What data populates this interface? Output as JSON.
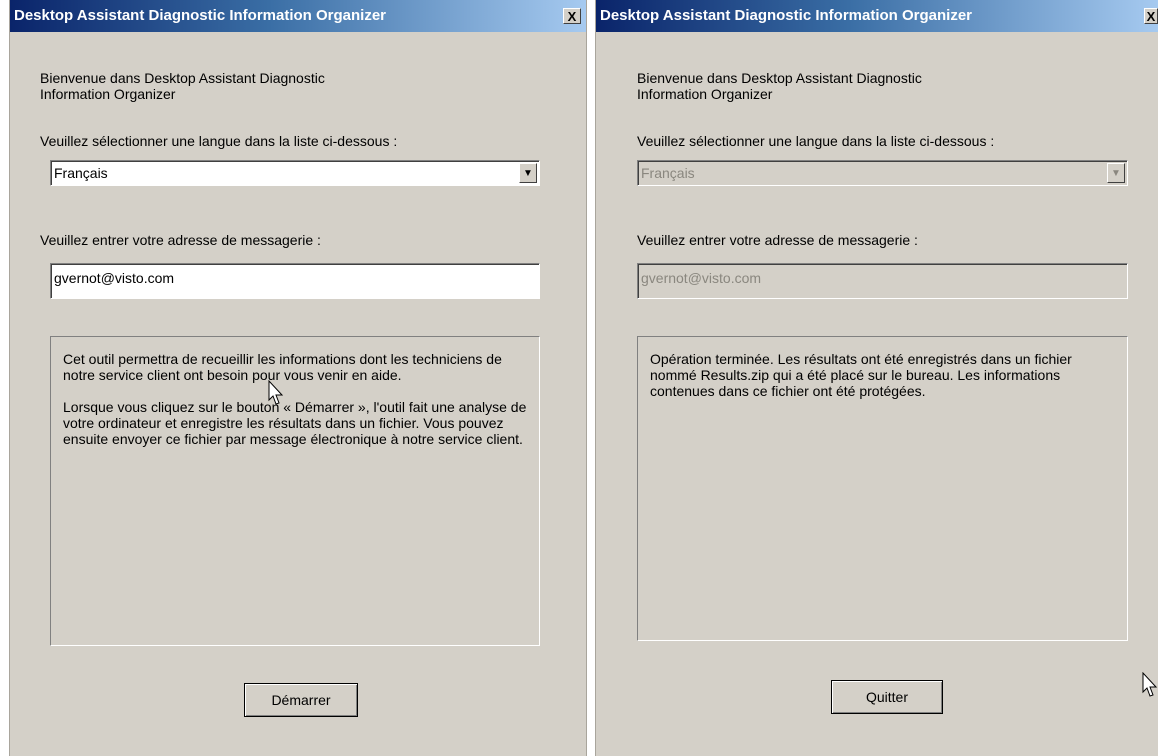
{
  "windows": [
    {
      "title": "Desktop Assistant Diagnostic Information Organizer",
      "close_label": "X",
      "welcome": "Bienvenue dans Desktop Assistant Diagnostic\nInformation Organizer",
      "language_prompt": "Veuillez sélectionner une langue dans la liste ci-dessous :",
      "language_value": "Français",
      "email_prompt": "Veuillez entrer votre adresse de messagerie :",
      "email_value": "gvernot@visto.com",
      "info_text": "Cet outil permettra de recueillir les informations dont les techniciens de notre service client ont besoin pour vous venir en aide.\n\nLorsque vous cliquez sur le bouton « Démarrer », l'outil fait une analyse de votre ordinateur et enregistre les résultats dans un fichier. Vous pouvez ensuite envoyer ce fichier par message électronique à notre service client.",
      "button_label": "Démarrer",
      "enabled": true
    },
    {
      "title": "Desktop Assistant Diagnostic Information Organizer",
      "close_label": "X",
      "welcome": "Bienvenue dans Desktop Assistant Diagnostic\nInformation Organizer",
      "language_prompt": "Veuillez sélectionner une langue dans la liste ci-dessous :",
      "language_value": "Français",
      "email_prompt": "Veuillez entrer votre adresse de messagerie :",
      "email_value": "gvernot@visto.com",
      "info_text": "Opération terminée. Les résultats ont été enregistrés dans un fichier nommé Results.zip qui a été placé sur le bureau. Les informations contenues dans ce fichier ont été protégées.",
      "button_label": "Quitter",
      "enabled": false
    }
  ],
  "icons": {
    "close": "close-icon",
    "dropdown": "chevron-down-icon",
    "cursor": "mouse-pointer-icon"
  },
  "colors": {
    "titlebar_start": "#0a246a",
    "titlebar_end": "#a6caf0",
    "window_bg": "#d4d0c8",
    "disabled_text": "#8a877f"
  }
}
